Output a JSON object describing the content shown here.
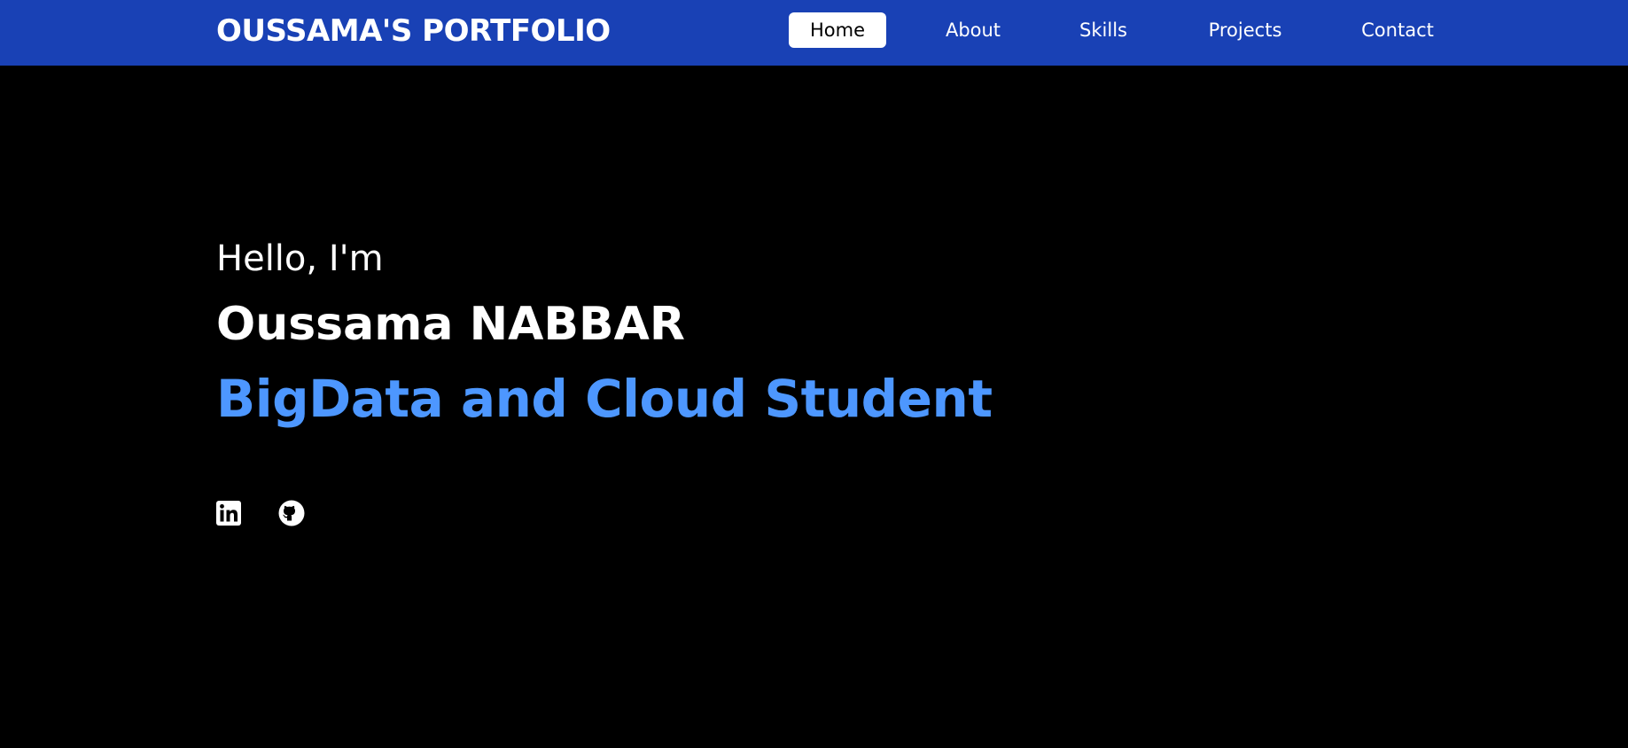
{
  "navbar": {
    "brand": "OUSSAMA'S PORTFOLIO",
    "items": [
      {
        "label": "Home",
        "active": true
      },
      {
        "label": "About",
        "active": false
      },
      {
        "label": "Skills",
        "active": false
      },
      {
        "label": "Projects",
        "active": false
      },
      {
        "label": "Contact",
        "active": false
      }
    ],
    "background": "#1941b5"
  },
  "hero": {
    "greeting": "Hello, I'm",
    "name": "Oussama NABBAR",
    "role": "BigData and Cloud Student",
    "role_color": "#4d97ff"
  },
  "social": [
    {
      "icon": "linkedin-icon"
    },
    {
      "icon": "github-icon"
    }
  ],
  "page": {
    "background": "#000000"
  }
}
